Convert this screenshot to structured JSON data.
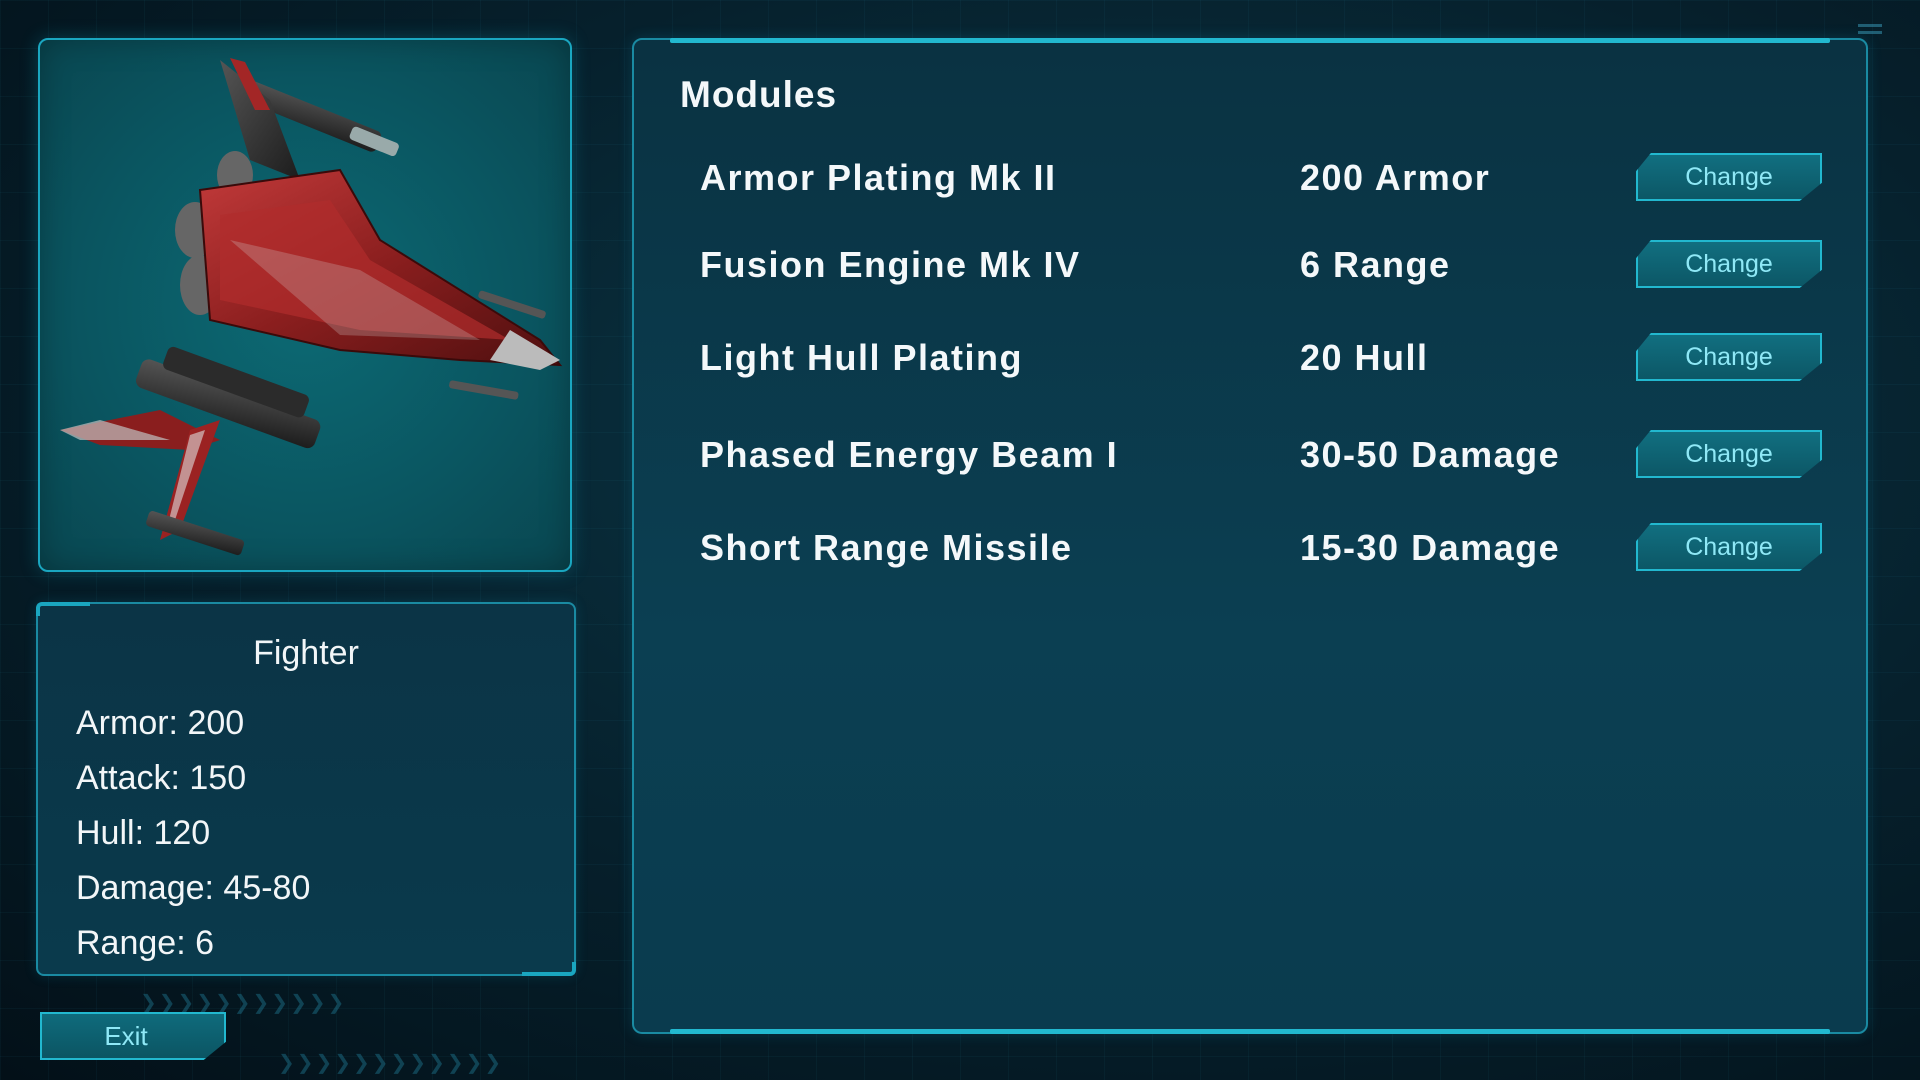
{
  "ship": {
    "name": "Fighter",
    "stats": [
      {
        "label": "Armor: 200"
      },
      {
        "label": "Attack: 150"
      },
      {
        "label": "Hull: 120"
      },
      {
        "label": "Damage: 45-80"
      },
      {
        "label": "Range: 6"
      }
    ]
  },
  "modules": {
    "title": "Modules",
    "rows": [
      {
        "name": "Armor Plating Mk II",
        "value": "200 Armor",
        "button": "Change"
      },
      {
        "name": "Fusion Engine Mk IV",
        "value": "6 Range",
        "button": "Change"
      },
      {
        "name": "Light Hull Plating",
        "value": "20 Hull",
        "button": "Change"
      },
      {
        "name": "Phased Energy Beam I",
        "value": "30-50 Damage",
        "button": "Change"
      },
      {
        "name": "Short Range Missile",
        "value": "15-30 Damage",
        "button": "Change"
      }
    ]
  },
  "exit_label": "Exit",
  "colors": {
    "accent": "#22b8cf",
    "button_text": "#8fe8f6",
    "panel_bg": "#0a3a4c",
    "ship_hull": "#8a1e1e"
  }
}
